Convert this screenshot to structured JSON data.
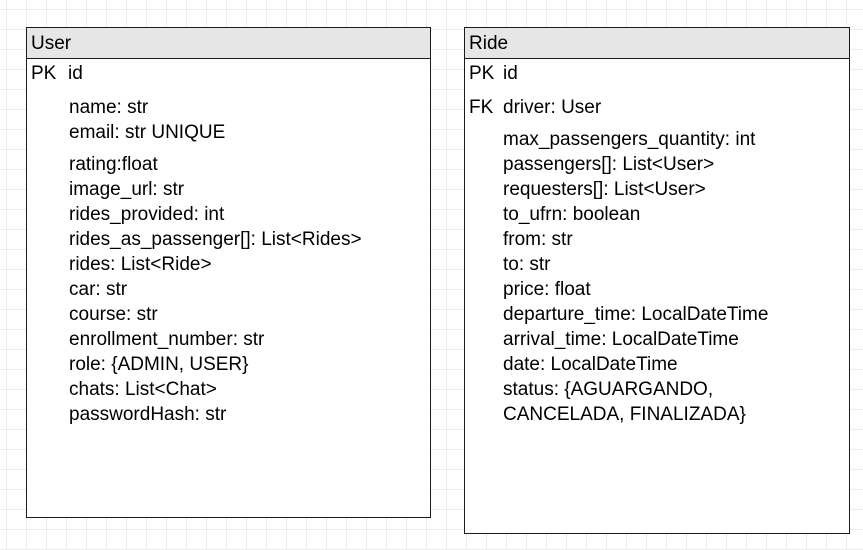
{
  "user": {
    "title": "User",
    "pk_label": "PK",
    "pk_name": "id",
    "fields_a": [
      "name: str",
      "email: str UNIQUE"
    ],
    "fields_b": [
      "rating:float",
      "image_url: str",
      "rides_provided: int",
      "rides_as_passenger[]: List<Rides>",
      "rides: List<Ride>",
      "car: str",
      "course: str",
      "enrollment_number: str",
      "role: {ADMIN, USER}",
      "chats: List<Chat>",
      "passwordHash: str"
    ]
  },
  "ride": {
    "title": "Ride",
    "pk_label": "PK",
    "pk_name": "id",
    "fk_label": "FK",
    "fk_name": "driver: User",
    "fields": [
      "max_passengers_quantity: int",
      "passengers[]: List<User>",
      "requesters[]: List<User>",
      "to_ufrn: boolean",
      "from: str",
      "to: str",
      "price: float",
      "departure_time: LocalDateTime",
      "arrival_time: LocalDateTime",
      "date: LocalDateTime",
      "status: {AGUARGANDO,",
      "CANCELADA, FINALIZADA}"
    ]
  }
}
